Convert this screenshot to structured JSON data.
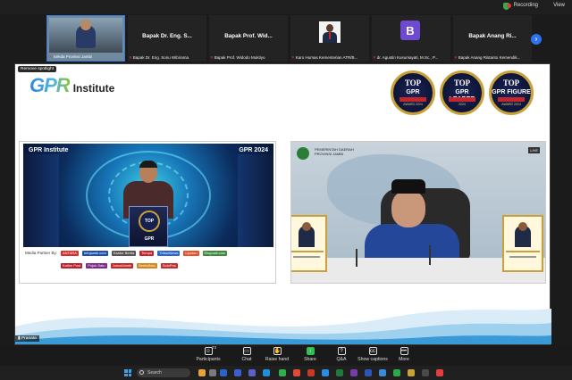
{
  "topbar": {
    "recording_label": "Recording",
    "view_label": "View"
  },
  "participants_strip": [
    {
      "name": "",
      "caption": "Sekda Provinsi Jambi",
      "type": "video"
    },
    {
      "name": "Bapak Dr. Eng. S...",
      "caption": "Bapak Dr. Eng. Sonu Wibirama",
      "type": "name"
    },
    {
      "name": "Bapak Prof. Wid...",
      "caption": "Bapak Prof. Widodo Muktiyo",
      "type": "name"
    },
    {
      "name": "",
      "caption": "Karo Humas Kementerian ATR/B...",
      "type": "photo"
    },
    {
      "name": "",
      "caption": "dr. Agustin Kusumayati, M.Sc., P...",
      "type": "initial",
      "initial": "B"
    },
    {
      "name": "Bapak Anang Ri...",
      "caption": "Bapak Anang Ristanto Kemendik...",
      "type": "name"
    }
  ],
  "shared_screen": {
    "spotlight_label": "Remove spotlight",
    "logo_mark": "GPR",
    "logo_text": "Institute",
    "badges": [
      {
        "line1": "TOP",
        "line2": "GPR",
        "line3": "AWARD 2024"
      },
      {
        "line1": "TOP",
        "line2": "GPR LEADER",
        "line3": "2024"
      },
      {
        "line1": "TOP",
        "line2": "GPR FIGURE",
        "line3": "AWARD 2024"
      }
    ],
    "stage_logo_left": "GPR Institute",
    "stage_logo_right": "GPR 2024",
    "podium_text": "TOP GPR",
    "media_partner_label": "Media Partner By:",
    "sponsors_row1": [
      "ANTARA",
      "Infojambi.com",
      "Kantor Berita",
      "Tempo",
      "TribunNews",
      "Liputan",
      "Eksposit.com",
      "Logo"
    ],
    "sponsors_row2": [
      "Kaltim Post",
      "Logo",
      "Logo",
      "Pojok Satu",
      "JurnalJambi",
      "Logo",
      "BeritaSatu",
      "SoloPos"
    ],
    "right_header_line1": "PEMERINTAH DAERAH",
    "right_header_line2": "PROVINSI JAMBI",
    "right_corner_logo": "LIVE"
  },
  "speaker_name_tag": "Pranata",
  "toolbar": {
    "participants_label": "Participants",
    "participants_count": "73",
    "chat_label": "Chat",
    "raise_hand_label": "Raise hand",
    "share_label": "Share",
    "qa_label": "Q&A",
    "show_captions_label": "Show captions",
    "more_label": "More"
  },
  "taskbar": {
    "search_placeholder": "Search"
  },
  "colors": {
    "accent_blue": "#2f72ee",
    "share_green": "#2fbf55",
    "recording_red": "#e23b3b",
    "gold": "#c9a13a"
  }
}
